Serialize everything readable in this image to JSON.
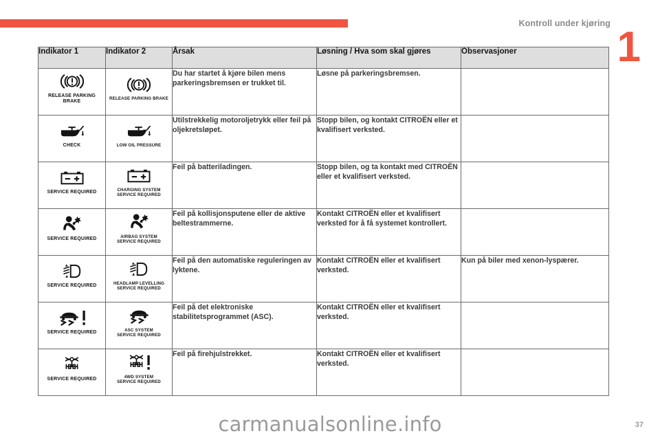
{
  "header": {
    "chapter_title": "Kontroll under kjøring",
    "chapter_number": "1",
    "accent_color": "#ef5540"
  },
  "table": {
    "columns": [
      {
        "key": "indikator1",
        "label": "Indikator 1"
      },
      {
        "key": "indikator2",
        "label": "Indikator 2"
      },
      {
        "key": "arsak",
        "label": "Årsak"
      },
      {
        "key": "losning",
        "label": "Løsning / Hva som skal gjøres"
      },
      {
        "key": "observasjoner",
        "label": "Observasjoner"
      }
    ],
    "rows": [
      {
        "indikator1_icon": "parking-brake-warning-icon",
        "indikator1_caption": "RELEASE PARKING\nBRAKE",
        "indikator2_icon": "parking-brake-warning-icon",
        "indikator2_caption": "RELEASE PARKING BRAKE",
        "arsak": "Du har startet å kjøre bilen mens parkeringsbremsen er trukket til.",
        "losning": "Løsne på parkeringsbremsen.",
        "observasjoner": ""
      },
      {
        "indikator1_icon": "oil-pressure-warning-icon",
        "indikator1_caption": "CHECK",
        "indikator2_icon": "oil-pressure-warning-icon",
        "indikator2_caption": "LOW OIL PRESSURE",
        "arsak": "Utilstrekkelig motoroljetrykk eller feil på oljekretsløpet.",
        "losning": "Stopp bilen, og kontakt CITROËN eller et kvalifisert verksted.",
        "observasjoner": ""
      },
      {
        "indikator1_icon": "battery-charge-warning-icon",
        "indikator1_caption": "SERVICE REQUIRED",
        "indikator2_icon": "battery-charge-warning-icon",
        "indikator2_caption": "CHARGING SYSTEM\nSERVICE REQUIRED",
        "arsak": "Feil på batteriladingen.",
        "losning": "Stopp bilen, og ta kontakt med CITROËN eller et kvalifisert verksted.",
        "observasjoner": ""
      },
      {
        "indikator1_icon": "airbag-warning-icon",
        "indikator1_caption": "SERVICE REQUIRED",
        "indikator2_icon": "airbag-warning-icon",
        "indikator2_caption": "AIRBAG SYSTEM\nSERVICE REQUIRED",
        "arsak": "Feil på kollisjonsputene eller de aktive beltestrammerne.",
        "losning": "Kontakt CITROËN eller et kvalifisert verksted for å få systemet kontrollert.",
        "observasjoner": ""
      },
      {
        "indikator1_icon": "headlamp-levelling-warning-icon",
        "indikator1_caption": "SERVICE REQUIRED",
        "indikator2_icon": "headlamp-levelling-warning-icon",
        "indikator2_caption": "HEADLAMP LEVELLING\nSERVICE REQUIRED",
        "arsak": "Feil på den automatiske reguleringen av lyktene.",
        "losning": "Kontakt CITROËN eller et kvalifisert verksted.",
        "observasjoner": "Kun på biler med xenon-lyspærer."
      },
      {
        "indikator1_icon": "asc-stability-warning-icon",
        "indikator1_caption": "SERVICE REQUIRED",
        "indikator2_icon": "asc-stability-warning-icon",
        "indikator2_caption": "ASC SYSTEM\nSERVICE REQUIRED",
        "arsak": "Feil på det elektroniske stabilitetsprogrammet (ASC).",
        "losning": "Kontakt CITROËN eller et kvalifisert verksted.",
        "observasjoner": ""
      },
      {
        "indikator1_icon": "four-wheel-drive-warning-icon",
        "indikator1_caption": "SERVICE REQUIRED",
        "indikator2_icon": "four-wheel-drive-warning-icon",
        "indikator2_caption": "4WD SYSTEM\nSERVICE REQUIRED",
        "arsak": "Feil på firehjulstrekket.",
        "losning": "Kontakt CITROËN eller et kvalifisert verksted.",
        "observasjoner": ""
      }
    ]
  },
  "footer": {
    "watermark": "carmanualsonline.info",
    "page_number": "37"
  }
}
